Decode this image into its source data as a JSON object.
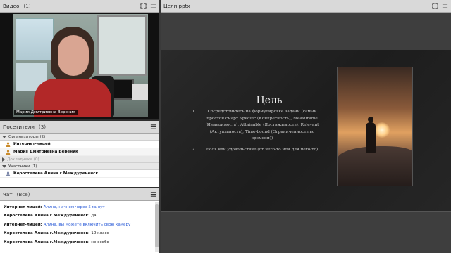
{
  "video_pod": {
    "title": "Видео",
    "count": "(1)",
    "speaker_name": "Мария Дмитриевна Вереник"
  },
  "attendees_pod": {
    "title": "Посетители",
    "count": "(3)",
    "groups": [
      {
        "label": "Организаторы (2)",
        "members": [
          "Интернет-лицей",
          "Мария Дмитриевна Вереник"
        ]
      },
      {
        "label": "Докладчики (0)",
        "members": []
      },
      {
        "label": "Участники (1)",
        "members": [
          "Коростелева Алина г.Междуреченск"
        ]
      }
    ]
  },
  "chat_pod": {
    "title": "Чат",
    "scope": "(Все)",
    "messages": [
      {
        "sender": "Интернет-лицей:",
        "text": "Алина, начнем через 5 минут",
        "highlight": true
      },
      {
        "sender": "Коростелева Алина г.Междуреченск:",
        "text": "да",
        "highlight": false
      },
      {
        "sender": "Интернет-лицей:",
        "text": "Алина, вы можете включить свою камеру",
        "highlight": true
      },
      {
        "sender": "Коростелева Алина г.Междуреченск:",
        "text": "10 класс",
        "highlight": false
      },
      {
        "sender": "Коростелева Алина г.Междуреченск:",
        "text": "не особо",
        "highlight": false
      }
    ]
  },
  "share_pod": {
    "title": "Цели.pptx",
    "slide": {
      "title": "Цель",
      "items": [
        {
          "num": "1.",
          "text": "Сосредоточьтесь на формулировке задачи (самый простой смарт Specific (Конкретность), Measurable (Измеримость), Attainable (Достижимость), Relevant (Актуальность), Time-bound (Ограниченность во времени))"
        },
        {
          "num": "2.",
          "text": "Боль или удовольствие (от чего-то или для чего-то)"
        }
      ]
    }
  },
  "colors": {
    "header_bg": "#d9d9d9",
    "chat_highlight": "#2a5bd7",
    "slide_bg": "#232323"
  },
  "icons": {
    "fullscreen": "fullscreen-icon",
    "menu": "pod-menu-icon",
    "host": "host-person-icon",
    "participant": "participant-person-icon"
  }
}
